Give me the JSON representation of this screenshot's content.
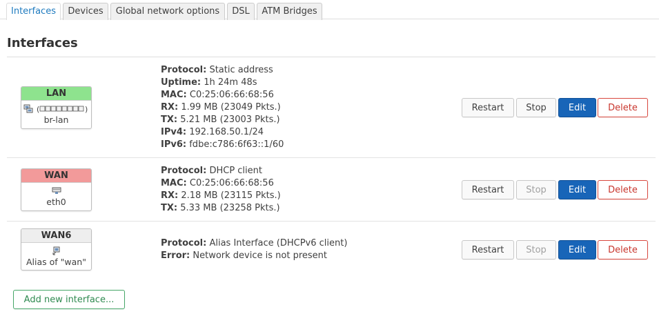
{
  "tabs": [
    "Interfaces",
    "Devices",
    "Global network options",
    "DSL",
    "ATM Bridges"
  ],
  "section_title": "Interfaces",
  "colors": {
    "lan": "#8ee38e",
    "wan": "#f29a9a",
    "wan6": "#eeeeee",
    "edit": "#1865b8",
    "delete": "#c8352c",
    "add": "#2f8a50"
  },
  "interfaces": [
    {
      "name": "LAN",
      "device": "br-lan",
      "icons": [
        "bridge-icon",
        "bridged-ports-icon"
      ],
      "protocol_label": "Protocol:",
      "protocol": "Static address",
      "uptime_label": "Uptime:",
      "uptime": "1h 24m 48s",
      "mac_label": "MAC:",
      "mac": "C0:25:06:66:68:56",
      "rx_label": "RX:",
      "rx": "1.99 MB (23049 Pkts.)",
      "tx_label": "TX:",
      "tx": "5.21 MB (23003 Pkts.)",
      "ipv4_label": "IPv4:",
      "ipv4": "192.168.50.1/24",
      "ipv6_label": "IPv6:",
      "ipv6": "fdbe:c786:6f63::1/60",
      "stop_enabled": true
    },
    {
      "name": "WAN",
      "device": "eth0",
      "icons": [
        "ethernet-icon"
      ],
      "protocol_label": "Protocol:",
      "protocol": "DHCP client",
      "mac_label": "MAC:",
      "mac": "C0:25:06:66:68:56",
      "rx_label": "RX:",
      "rx": "2.18 MB (23115 Pkts.)",
      "tx_label": "TX:",
      "tx": "5.33 MB (23258 Pkts.)",
      "stop_enabled": false
    },
    {
      "name": "WAN6",
      "device": "Alias of \"wan\"",
      "icons": [
        "alias-icon"
      ],
      "protocol_label": "Protocol:",
      "protocol": "Alias Interface (DHCPv6 client)",
      "error_label": "Error:",
      "error": "Network device is not present",
      "stop_enabled": false
    }
  ],
  "buttons": {
    "restart": "Restart",
    "stop": "Stop",
    "edit": "Edit",
    "delete": "Delete",
    "add": "Add new interface..."
  }
}
